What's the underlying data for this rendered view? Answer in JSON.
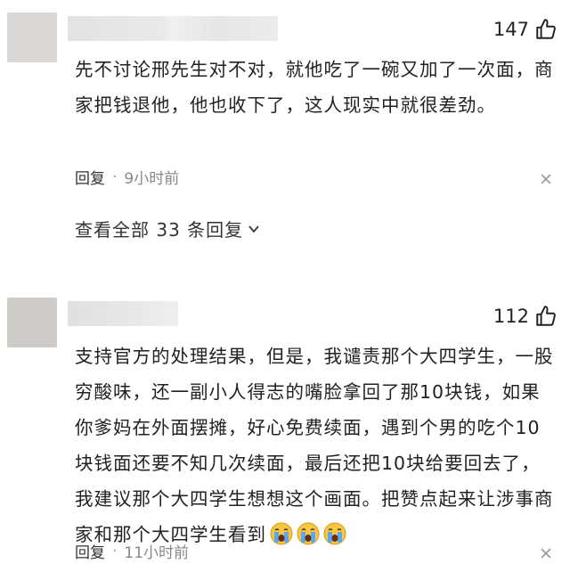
{
  "comments": [
    {
      "likes": "147",
      "text": "先不讨论邢先生对不对，就他吃了一碗又加了一次面，商家把钱退他，他也收下了，这人现实中就很差劲。",
      "reply_label": "回复",
      "separator": "·",
      "time": "9小时前",
      "view_all": "查看全部 33 条回复"
    },
    {
      "likes": "112",
      "text": "支持官方的处理结果，但是，我谴责那个大四学生，一股穷酸味，还一副小人得志的嘴脸拿回了那10块钱，如果你爹妈在外面摆摊，好心免费续面，遇到个男的吃个10块钱面还要不知几次续面，最后还把10块给要回去了，我建议那个大四学生想想这个画面。把赞点起来让涉事商家和那个大四学生看到",
      "reply_label": "回复",
      "separator": "·",
      "time": "11小时前"
    }
  ],
  "icons": {
    "like": "thumbs-up-icon",
    "more": "close-x-icon",
    "emoji": "crying-face-emoji"
  },
  "colors": {
    "text": "#222222",
    "meta": "#888888",
    "avatar": "#d9d6d3"
  }
}
